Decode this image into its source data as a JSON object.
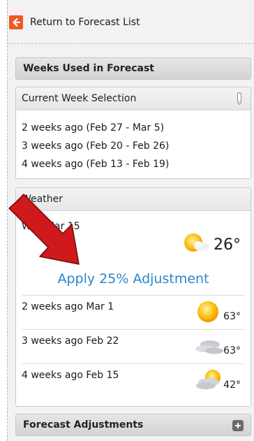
{
  "nav": {
    "return_label": "Return to Forecast List"
  },
  "weeks_section": {
    "title": "Weeks Used in Forecast"
  },
  "current_week": {
    "title": "Current Week Selection",
    "items": [
      "2 weeks ago (Feb 27 - Mar 5)",
      "3 weeks ago (Feb 20 - Feb 26)",
      "4 weeks ago (Feb 13 - Feb 19)"
    ]
  },
  "weather": {
    "title": "Weather",
    "current": {
      "date": "Wed Mar 15",
      "temp": "26°",
      "icon": "sun-cloud-icon"
    },
    "adjust_link": "Apply 25% Adjustment",
    "rows": [
      {
        "label": "2 weeks ago Mar 1",
        "temp": "63°",
        "icon": "sun-icon"
      },
      {
        "label": "3 weeks ago Feb 22",
        "temp": "63°",
        "icon": "cloud-icon"
      },
      {
        "label": "4 weeks ago Feb 15",
        "temp": "42°",
        "icon": "partly-cloudy-icon"
      }
    ]
  },
  "forecast_adjustments": {
    "title": "Forecast Adjustments"
  },
  "colors": {
    "accent_link": "#2b86c9",
    "return_icon": "#ef5a24",
    "arrow": "#d0191c"
  }
}
